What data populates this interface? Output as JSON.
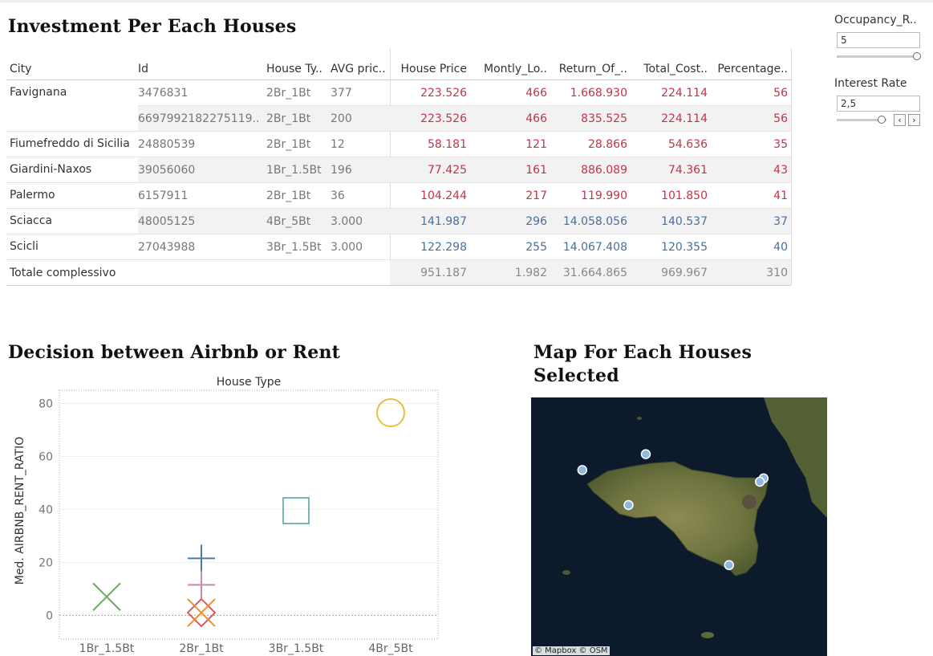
{
  "titles": {
    "investment": "Investment Per Each Houses",
    "decision": "Decision between  Airbnb or Rent",
    "map_line1": "Map For Each Houses",
    "map_line2": "Selected"
  },
  "table": {
    "headers": [
      "City",
      "Id",
      "House Ty..",
      "AVG pric..",
      "House Price",
      "Montly_Lo..",
      "Return_Of_..",
      "Total_Cost..",
      "Percentage.."
    ],
    "rows": [
      {
        "city": "Favignana",
        "id": "3476831",
        "house_type": "2Br_1Bt",
        "avg_price": "377",
        "house_price": "223.526",
        "monthly_loan": "466",
        "return_of": "1.668.930",
        "total_cost": "224.114",
        "percentage": "56",
        "tone": "red"
      },
      {
        "city": "",
        "id": "6697992182275119..",
        "house_type": "2Br_1Bt",
        "avg_price": "200",
        "house_price": "223.526",
        "monthly_loan": "466",
        "return_of": "835.525",
        "total_cost": "224.114",
        "percentage": "56",
        "tone": "red"
      },
      {
        "city": "Fiumefreddo di Sicilia",
        "id": "24880539",
        "house_type": "2Br_1Bt",
        "avg_price": "12",
        "house_price": "58.181",
        "monthly_loan": "121",
        "return_of": "28.866",
        "total_cost": "54.636",
        "percentage": "35",
        "tone": "red"
      },
      {
        "city": "Giardini-Naxos",
        "id": "39056060",
        "house_type": "1Br_1.5Bt",
        "avg_price": "196",
        "house_price": "77.425",
        "monthly_loan": "161",
        "return_of": "886.089",
        "total_cost": "74.361",
        "percentage": "43",
        "tone": "red"
      },
      {
        "city": "Palermo",
        "id": "6157911",
        "house_type": "2Br_1Bt",
        "avg_price": "36",
        "house_price": "104.244",
        "monthly_loan": "217",
        "return_of": "119.990",
        "total_cost": "101.850",
        "percentage": "41",
        "tone": "red"
      },
      {
        "city": "Sciacca",
        "id": "48005125",
        "house_type": "4Br_5Bt",
        "avg_price": "3.000",
        "house_price": "141.987",
        "monthly_loan": "296",
        "return_of": "14.058.056",
        "total_cost": "140.537",
        "percentage": "37",
        "tone": "blue"
      },
      {
        "city": "Scicli",
        "id": "27043988",
        "house_type": "3Br_1.5Bt",
        "avg_price": "3.000",
        "house_price": "122.298",
        "monthly_loan": "255",
        "return_of": "14.067.408",
        "total_cost": "120.355",
        "percentage": "40",
        "tone": "blue"
      }
    ],
    "total": {
      "label": "Totale complessivo",
      "house_price": "951.187",
      "monthly_loan": "1.982",
      "return_of": "31.664.865",
      "total_cost": "969.967",
      "percentage": "310"
    }
  },
  "controls": {
    "occupancy": {
      "label": "Occupancy_R..",
      "value": "5",
      "slider_fraction": 1.0
    },
    "interest": {
      "label": "Interest Rate",
      "value": "2,5",
      "slider_fraction": 0.9,
      "prev": "‹",
      "next": "›"
    }
  },
  "colors": {
    "red": "#c0354a",
    "blue": "#4a6f9c"
  },
  "chart_data": {
    "type": "scatter",
    "title": "House Type",
    "ylabel": "Med. AIRBNB_RENT_RATIO",
    "categories": [
      "1Br_1.5Bt",
      "2Br_1Bt",
      "3Br_1.5Bt",
      "4Br_5Bt"
    ],
    "ylim": [
      -9,
      85
    ],
    "yticks": [
      0,
      20,
      40,
      60,
      80
    ],
    "points": [
      {
        "category": "1Br_1.5Bt",
        "y": 7,
        "shape": "x",
        "color": "#6aab5e"
      },
      {
        "category": "2Br_1Bt",
        "y": 21.5,
        "shape": "plus",
        "color": "#4e79a7"
      },
      {
        "category": "2Br_1Bt",
        "y": 11.5,
        "shape": "plus",
        "color": "#c98aa9"
      },
      {
        "category": "2Br_1Bt",
        "y": 1,
        "shape": "diamond",
        "color": "#e15759"
      },
      {
        "category": "2Br_1Bt",
        "y": 1,
        "shape": "x",
        "color": "#f28e2b"
      },
      {
        "category": "3Br_1.5Bt",
        "y": 39.5,
        "shape": "square",
        "color": "#76b7b2"
      },
      {
        "category": "4Br_5Bt",
        "y": 76.5,
        "shape": "circle",
        "color": "#e4c043"
      }
    ]
  },
  "map": {
    "credit": "© Mapbox © OSM",
    "markers": [
      {
        "city": "Favignana",
        "lon": 12.33,
        "lat": 37.93
      },
      {
        "city": "Palermo",
        "lon": 13.36,
        "lat": 38.12
      },
      {
        "city": "Sciacca",
        "lon": 13.08,
        "lat": 37.51
      },
      {
        "city": "Giardini-Naxos",
        "lon": 15.27,
        "lat": 37.83
      },
      {
        "city": "Fiumefreddo di Sicilia",
        "lon": 15.21,
        "lat": 37.79
      },
      {
        "city": "Scicli",
        "lon": 14.71,
        "lat": 36.79
      }
    ]
  }
}
